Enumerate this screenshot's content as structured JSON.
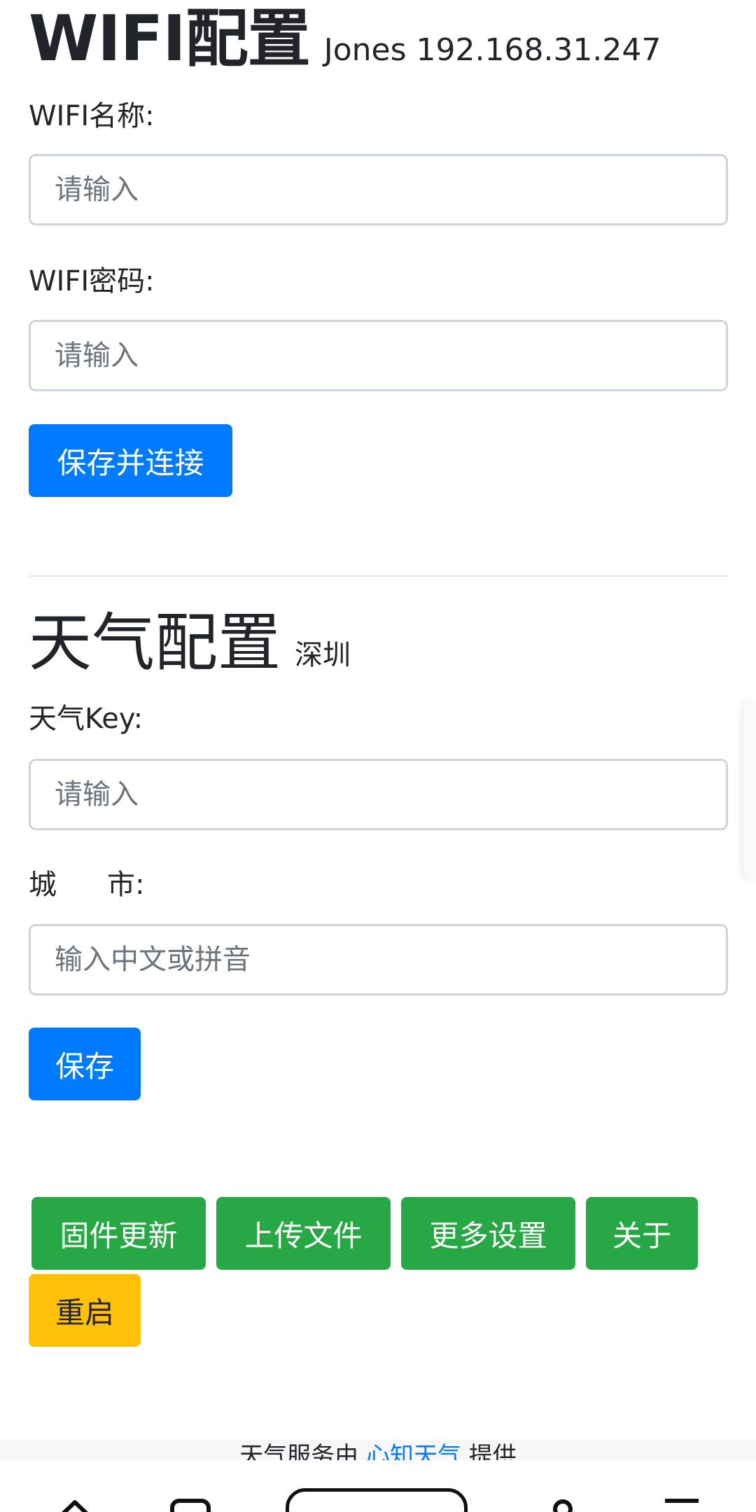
{
  "wifi_section": {
    "title": "WIFI配置",
    "subtitle": "Jones 192.168.31.247",
    "ssid_label": "WIFI名称:",
    "ssid_placeholder": "请输入",
    "password_label": "WIFI密码:",
    "password_placeholder": "请输入",
    "save_connect_button": "保存并连接"
  },
  "weather_section": {
    "title": "天气配置",
    "subtitle": "深圳",
    "key_label": "天气Key:",
    "key_placeholder": "请输入",
    "city_label_left": "城",
    "city_label_right": "市:",
    "city_placeholder": "输入中文或拼音",
    "save_button": "保存"
  },
  "actions": {
    "firmware_update": "固件更新",
    "upload_file": "上传文件",
    "more_settings": "更多设置",
    "about": "关于",
    "restart": "重启"
  },
  "footer": {
    "prefix": "天气服务由",
    "link": "心知天气",
    "suffix": "提供"
  },
  "browser_nav": {
    "icons": [
      "home-icon",
      "tabs-icon",
      "address-bar",
      "account-icon",
      "menu-icon"
    ]
  },
  "colors": {
    "primary": "#007bff",
    "success": "#28a745",
    "warning": "#ffc107"
  }
}
